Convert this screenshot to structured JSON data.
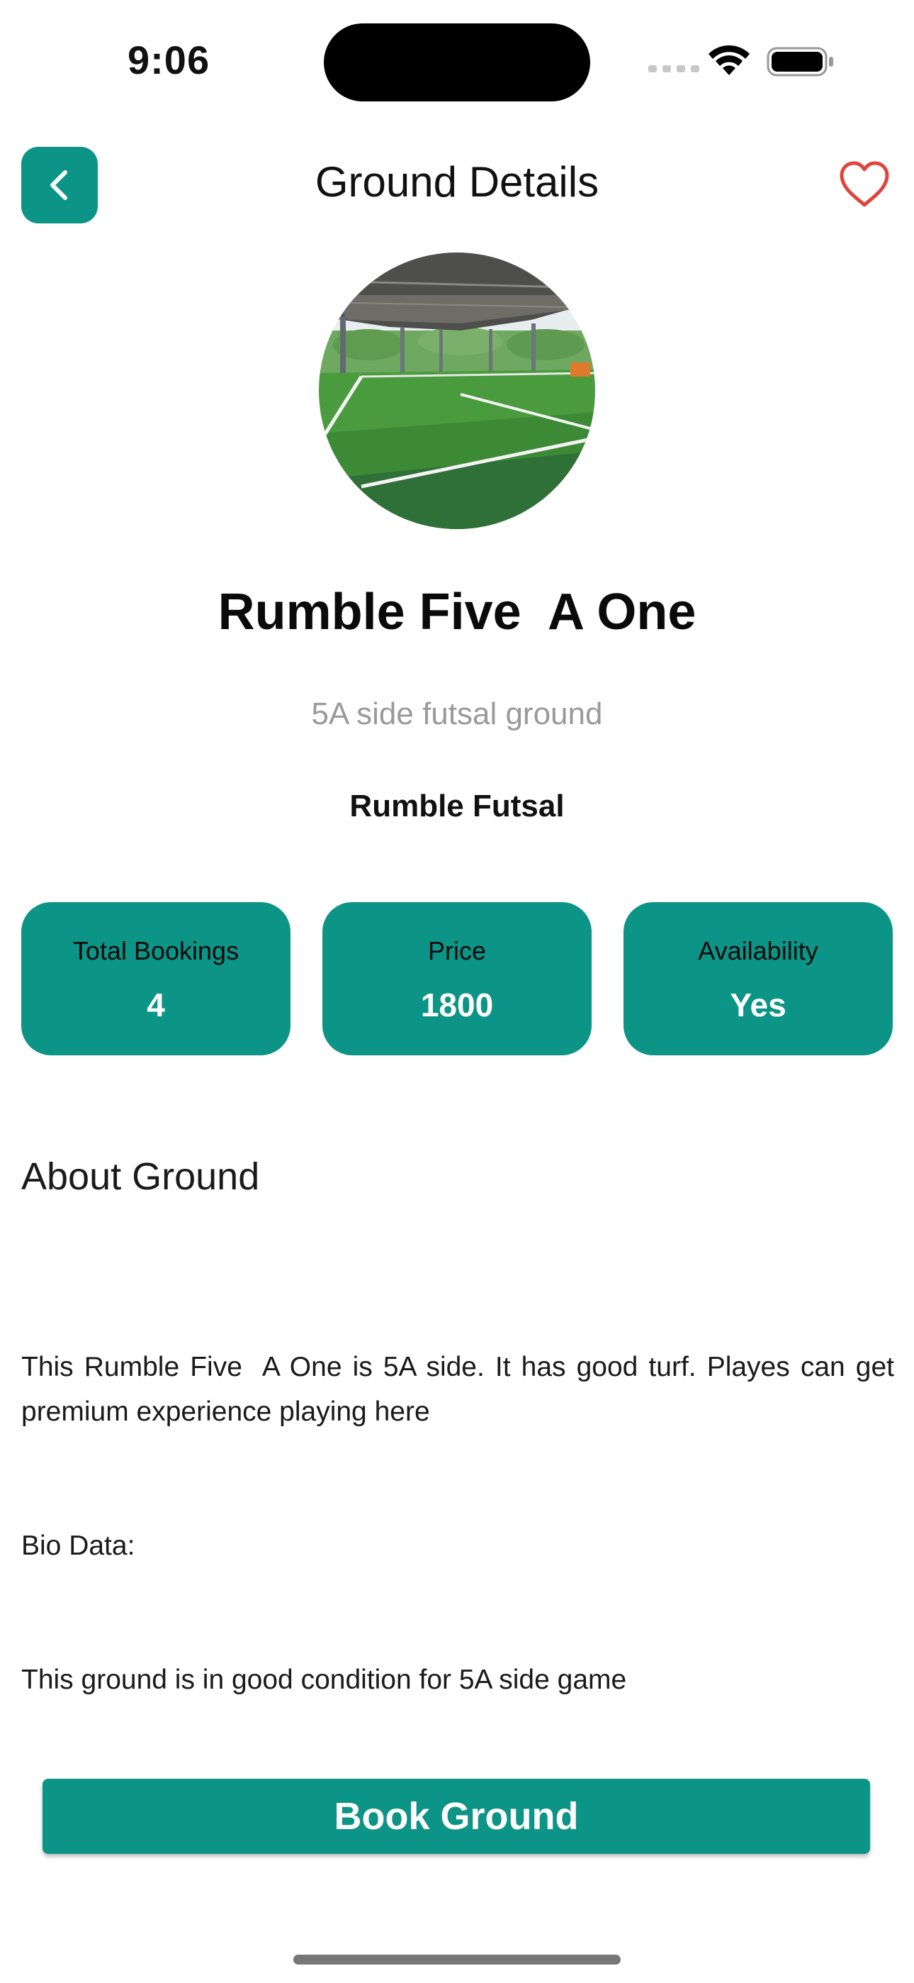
{
  "status_bar": {
    "time": "9:06"
  },
  "header": {
    "title": "Ground Details",
    "back_icon": "chevron-left-icon",
    "favorite_icon": "heart-outline-icon"
  },
  "ground": {
    "name": "Rumble Five  A One",
    "subtitle": "5A side futsal ground",
    "venue": "Rumble Futsal"
  },
  "stats": [
    {
      "label": "Total Bookings",
      "value": "4"
    },
    {
      "label": "Price",
      "value": "1800"
    },
    {
      "label": "Availability",
      "value": "Yes"
    }
  ],
  "about": {
    "heading": "About Ground",
    "description": "This Rumble Five  A One is 5A side. It has good turf. Playes can get premium experience playing here",
    "bio_label": "Bio Data:",
    "bio_text": "This ground is in good condition for 5A side game"
  },
  "actions": {
    "book_label": "Book Ground"
  },
  "colors": {
    "accent": "#0c9486",
    "favorite": "#e0443a",
    "subtitle": "#9a9a9a"
  }
}
